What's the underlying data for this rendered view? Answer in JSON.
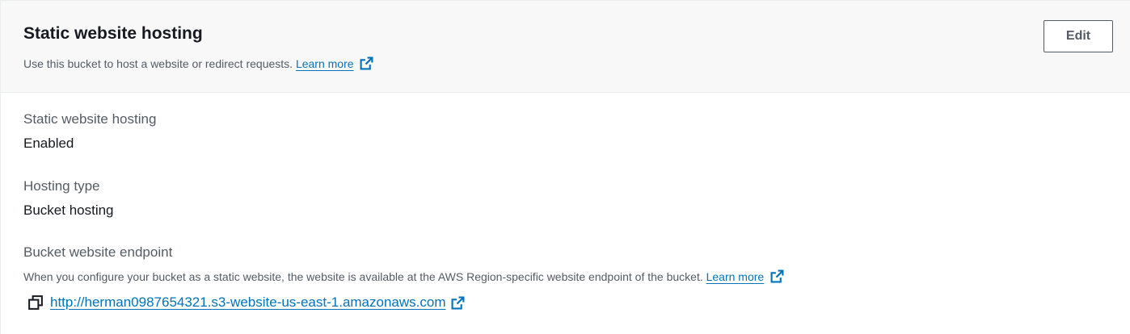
{
  "header": {
    "title": "Static website hosting",
    "description": "Use this bucket to host a website or redirect requests.",
    "learn_more": "Learn more",
    "edit_label": "Edit"
  },
  "fields": {
    "hosting": {
      "label": "Static website hosting",
      "value": "Enabled"
    },
    "hosting_type": {
      "label": "Hosting type",
      "value": "Bucket hosting"
    },
    "endpoint": {
      "label": "Bucket website endpoint",
      "description": "When you configure your bucket as a static website, the website is available at the AWS Region-specific website endpoint of the bucket.",
      "learn_more": "Learn more",
      "url": "http://herman0987654321.s3-website-us-east-1.amazonaws.com"
    }
  },
  "icons": {
    "external_link": "external-link-icon",
    "copy": "copy-icon"
  },
  "colors": {
    "link": "#0073bb",
    "header_bg": "#f8f8f8",
    "secondary_text": "#545b64",
    "primary_text": "#16191f"
  }
}
